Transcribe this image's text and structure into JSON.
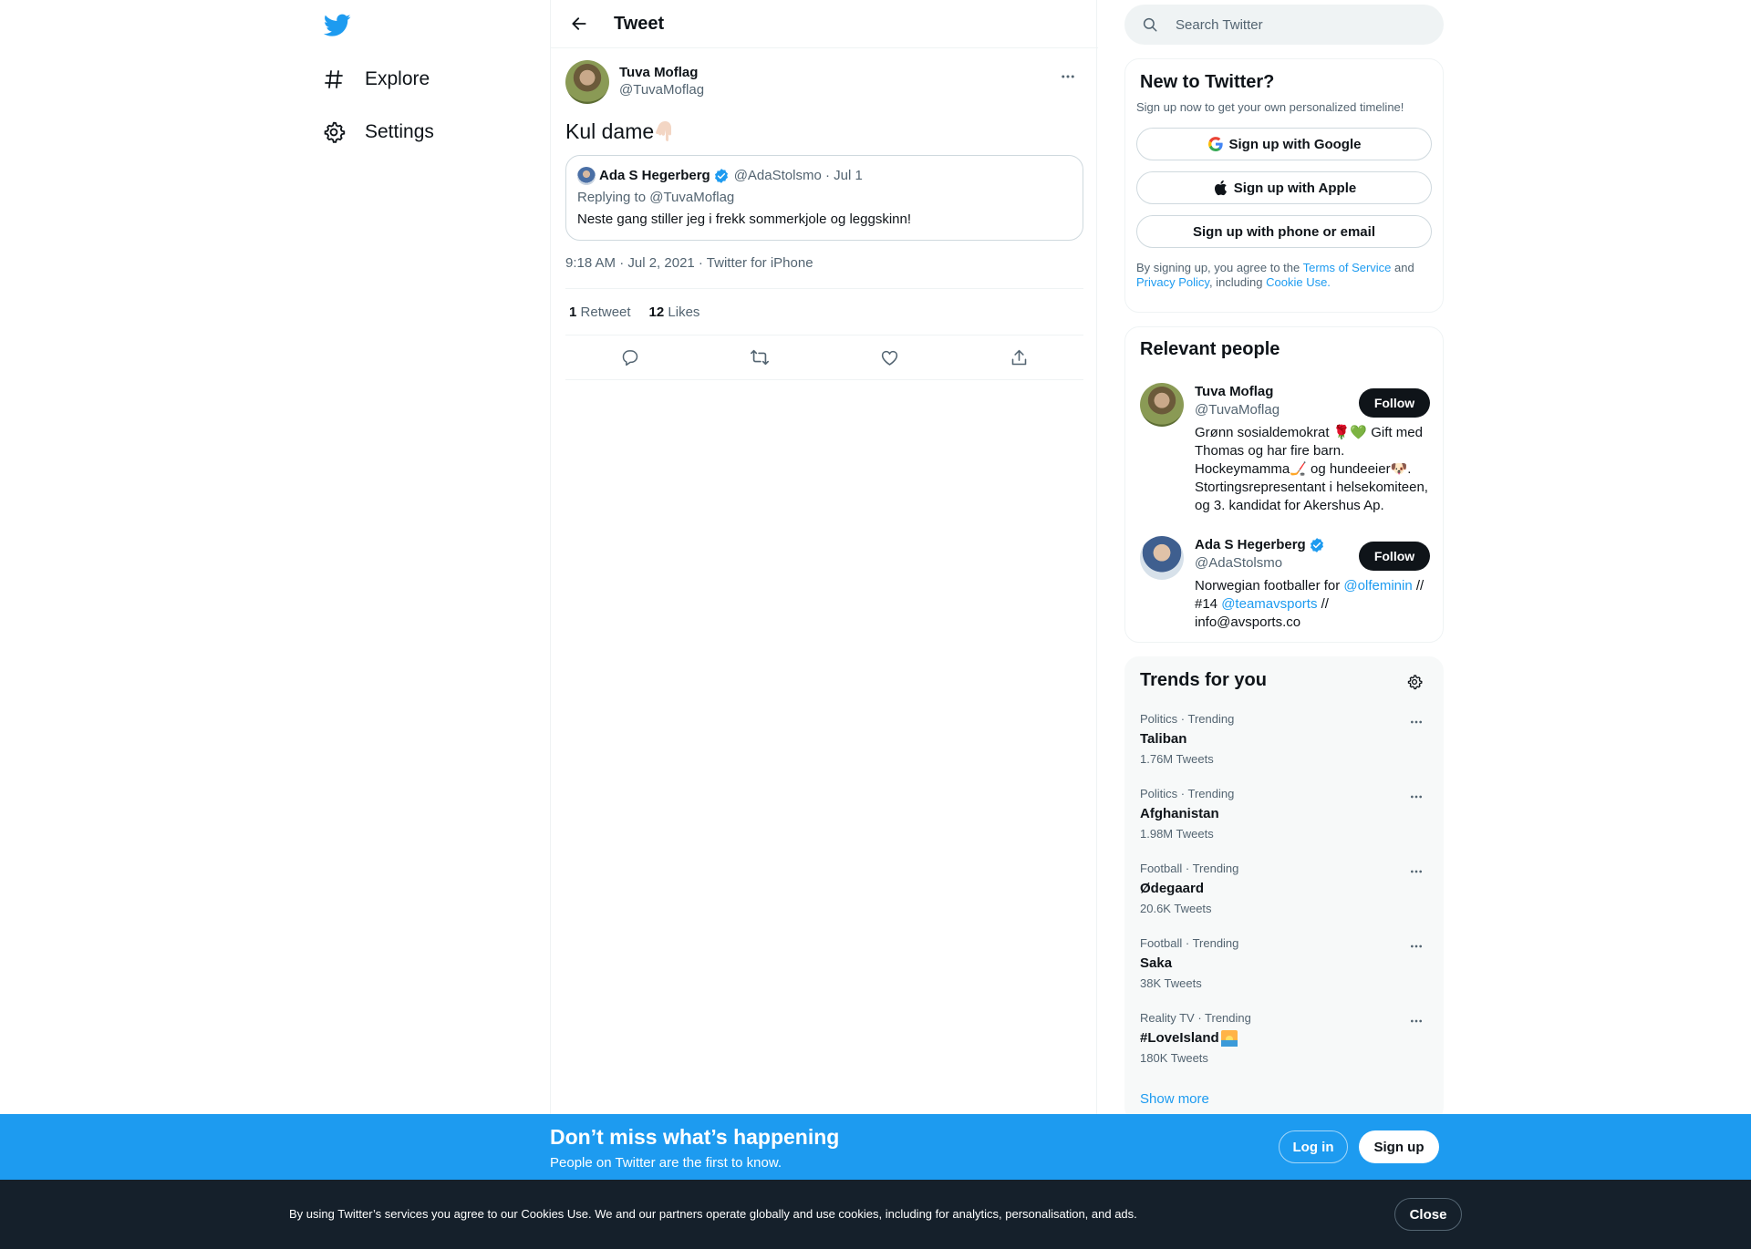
{
  "nav": {
    "logo": "twitter-bird-icon",
    "items": [
      {
        "label": "Explore",
        "icon": "hashtag-icon"
      },
      {
        "label": "Settings",
        "icon": "gear-icon"
      }
    ]
  },
  "header": {
    "title": "Tweet"
  },
  "tweet": {
    "author_name": "Tuva Moflag",
    "author_handle": "@TuvaMoflag",
    "text": "Kul dame",
    "quote": {
      "name": "Ada S Hegerberg",
      "handle_date": "@AdaStolsmo · Jul 1",
      "replying_prefix": "Replying to ",
      "replying_handle": "@TuvaMoflag",
      "body": "Neste gang stiller jeg i frekk sommerkjole og leggskinn!"
    },
    "timestamp": "9:18 AM · Jul 2, 2021 · Twitter for iPhone",
    "retweets_count": "1",
    "retweets_label": "Retweet",
    "likes_count": "12",
    "likes_label": "Likes"
  },
  "search": {
    "placeholder": "Search Twitter"
  },
  "new_to_twitter": {
    "title": "New to Twitter?",
    "subtitle": "Sign up now to get your own personalized timeline!",
    "google": "Sign up with Google",
    "apple": "Sign up with Apple",
    "phone": "Sign up with phone or email",
    "legal_1": "By signing up, you agree to the ",
    "terms": "Terms of Service",
    "legal_2": " and ",
    "privacy": "Privacy Policy",
    "legal_3": ", including ",
    "cookie": "Cookie Use."
  },
  "relevant_people": {
    "title": "Relevant people",
    "follow_label": "Follow",
    "people": [
      {
        "name": "Tuva Moflag",
        "handle": "@TuvaMoflag",
        "bio": "Grønn sosialdemokrat 🌹💚 Gift med Thomas og har fire barn. Hockeymamma🏒 og hundeeier🐶. Stortingsrepresentant i helsekomiteen, og 3. kandidat for Akershus Ap."
      },
      {
        "name": "Ada S Hegerberg",
        "handle": "@AdaStolsmo",
        "bio_1": "Norwegian footballer for ",
        "bio_link_1": "@olfeminin",
        "bio_2": " // #14 ",
        "bio_link_2": "@teamavsports",
        "bio_3": " // info@avsports.co"
      }
    ]
  },
  "trends": {
    "title": "Trends for you",
    "items": [
      {
        "context": "Politics · Trending",
        "name": "Taliban",
        "count": "1.76M Tweets"
      },
      {
        "context": "Politics · Trending",
        "name": "Afghanistan",
        "count": "1.98M Tweets"
      },
      {
        "context": "Football · Trending",
        "name": "Ødegaard",
        "count": "20.6K Tweets"
      },
      {
        "context": "Football · Trending",
        "name": "Saka",
        "count": "38K Tweets"
      },
      {
        "context": "Reality TV · Trending",
        "name": "#LoveIsland",
        "count": "180K Tweets"
      }
    ],
    "show_more": "Show more"
  },
  "banner": {
    "title": "Don’t miss what’s happening",
    "subtitle": "People on Twitter are the first to know.",
    "login": "Log in",
    "signup": "Sign up"
  },
  "cookie_bar": {
    "text": "By using Twitter’s services you agree to our Cookies Use. We and our partners operate globally and use cookies, including for analytics, personalisation, and ads.",
    "close": "Close"
  },
  "colors": {
    "accent": "#1d9bf0",
    "text": "#0f1419",
    "secondary": "#536471"
  }
}
